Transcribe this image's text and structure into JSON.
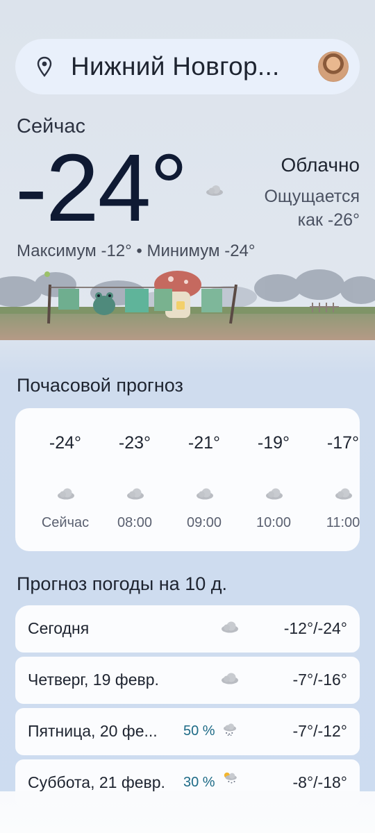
{
  "search": {
    "location": "Нижний Новгор...",
    "pin_icon": "location-pin-icon",
    "avatar_icon": "user-avatar"
  },
  "current": {
    "label": "Сейчас",
    "temperature": "-24°",
    "condition": "Облачно",
    "feels_like_line1": "Ощущается",
    "feels_like_line2": "как -26°",
    "minmax": "Максимум -12° • Минимум -24°",
    "condition_icon": "cloud-icon"
  },
  "hourly": {
    "title": "Почасовой прогноз",
    "items": [
      {
        "temp": "-24°",
        "time": "Сейчас",
        "icon": "cloud-icon"
      },
      {
        "temp": "-23°",
        "time": "08:00",
        "icon": "cloud-icon"
      },
      {
        "temp": "-21°",
        "time": "09:00",
        "icon": "cloud-icon"
      },
      {
        "temp": "-19°",
        "time": "10:00",
        "icon": "cloud-icon"
      },
      {
        "temp": "-17°",
        "time": "11:00",
        "icon": "cloud-icon"
      }
    ]
  },
  "daily": {
    "title": "Прогноз погоды на 10 д.",
    "items": [
      {
        "day": "Сегодня",
        "precip": "",
        "range": "-12°/-24°",
        "icon": "cloud-icon"
      },
      {
        "day": "Четверг, 19 февр.",
        "precip": "",
        "range": "-7°/-16°",
        "icon": "cloud-icon"
      },
      {
        "day": "Пятница, 20 фе...",
        "precip": "50 %",
        "range": "-7°/-12°",
        "icon": "snow-cloud-icon"
      },
      {
        "day": "Суббота, 21 февр.",
        "precip": "30 %",
        "range": "-8°/-18°",
        "icon": "sun-snow-cloud-icon"
      }
    ]
  },
  "colors": {
    "accent_precip": "#1d6a86",
    "card_bg": "#fbfcfe",
    "page_bg": "#cddcf0"
  }
}
